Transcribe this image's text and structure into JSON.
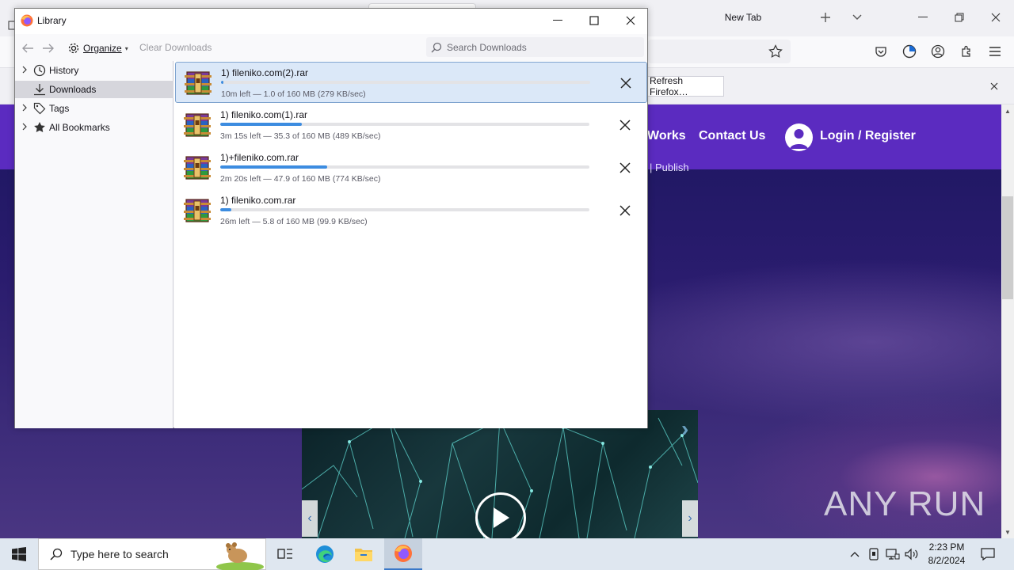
{
  "browser": {
    "tab_title": "New Tab",
    "notification_button": "Refresh Firefox…"
  },
  "website": {
    "nav_works": "Works",
    "nav_contact": "Contact Us",
    "nav_login": "Login / Register",
    "hero_fragment": "Publish"
  },
  "watermark": "ANY RUN",
  "library": {
    "title": "Library",
    "toolbar": {
      "organize_label": "Organize",
      "clear_downloads_label": "Clear Downloads",
      "search_placeholder": "Search Downloads"
    },
    "sidebar": {
      "items": [
        {
          "label": "History",
          "icon": "clock-icon",
          "expandable": true,
          "selected": false
        },
        {
          "label": "Downloads",
          "icon": "download-icon",
          "expandable": false,
          "selected": true
        },
        {
          "label": "Tags",
          "icon": "tag-icon",
          "expandable": true,
          "selected": false
        },
        {
          "label": "All Bookmarks",
          "icon": "star-icon",
          "expandable": true,
          "selected": false
        }
      ]
    },
    "downloads": [
      {
        "name": "1) fileniko.com(2).rar",
        "status": "10m left — 1.0 of 160 MB (279 KB/sec)",
        "progress": 0.006,
        "selected": true
      },
      {
        "name": "1) fileniko.com(1).rar",
        "status": "3m 15s left — 35.3 of 160 MB (489 KB/sec)",
        "progress": 0.22,
        "selected": false
      },
      {
        "name": "1)+fileniko.com.rar",
        "status": "2m 20s left — 47.9 of 160 MB (774 KB/sec)",
        "progress": 0.29,
        "selected": false
      },
      {
        "name": "1) fileniko.com.rar",
        "status": "26m left — 5.8 of 160 MB (99.9 KB/sec)",
        "progress": 0.03,
        "selected": false
      }
    ]
  },
  "taskbar": {
    "search_placeholder": "Type here to search",
    "time": "2:23 PM",
    "date": "8/2/2024"
  },
  "colors": {
    "progress_fill": "#3c8ce0",
    "site_header": "#5b2bc0",
    "selection": "#dbe8f8"
  }
}
